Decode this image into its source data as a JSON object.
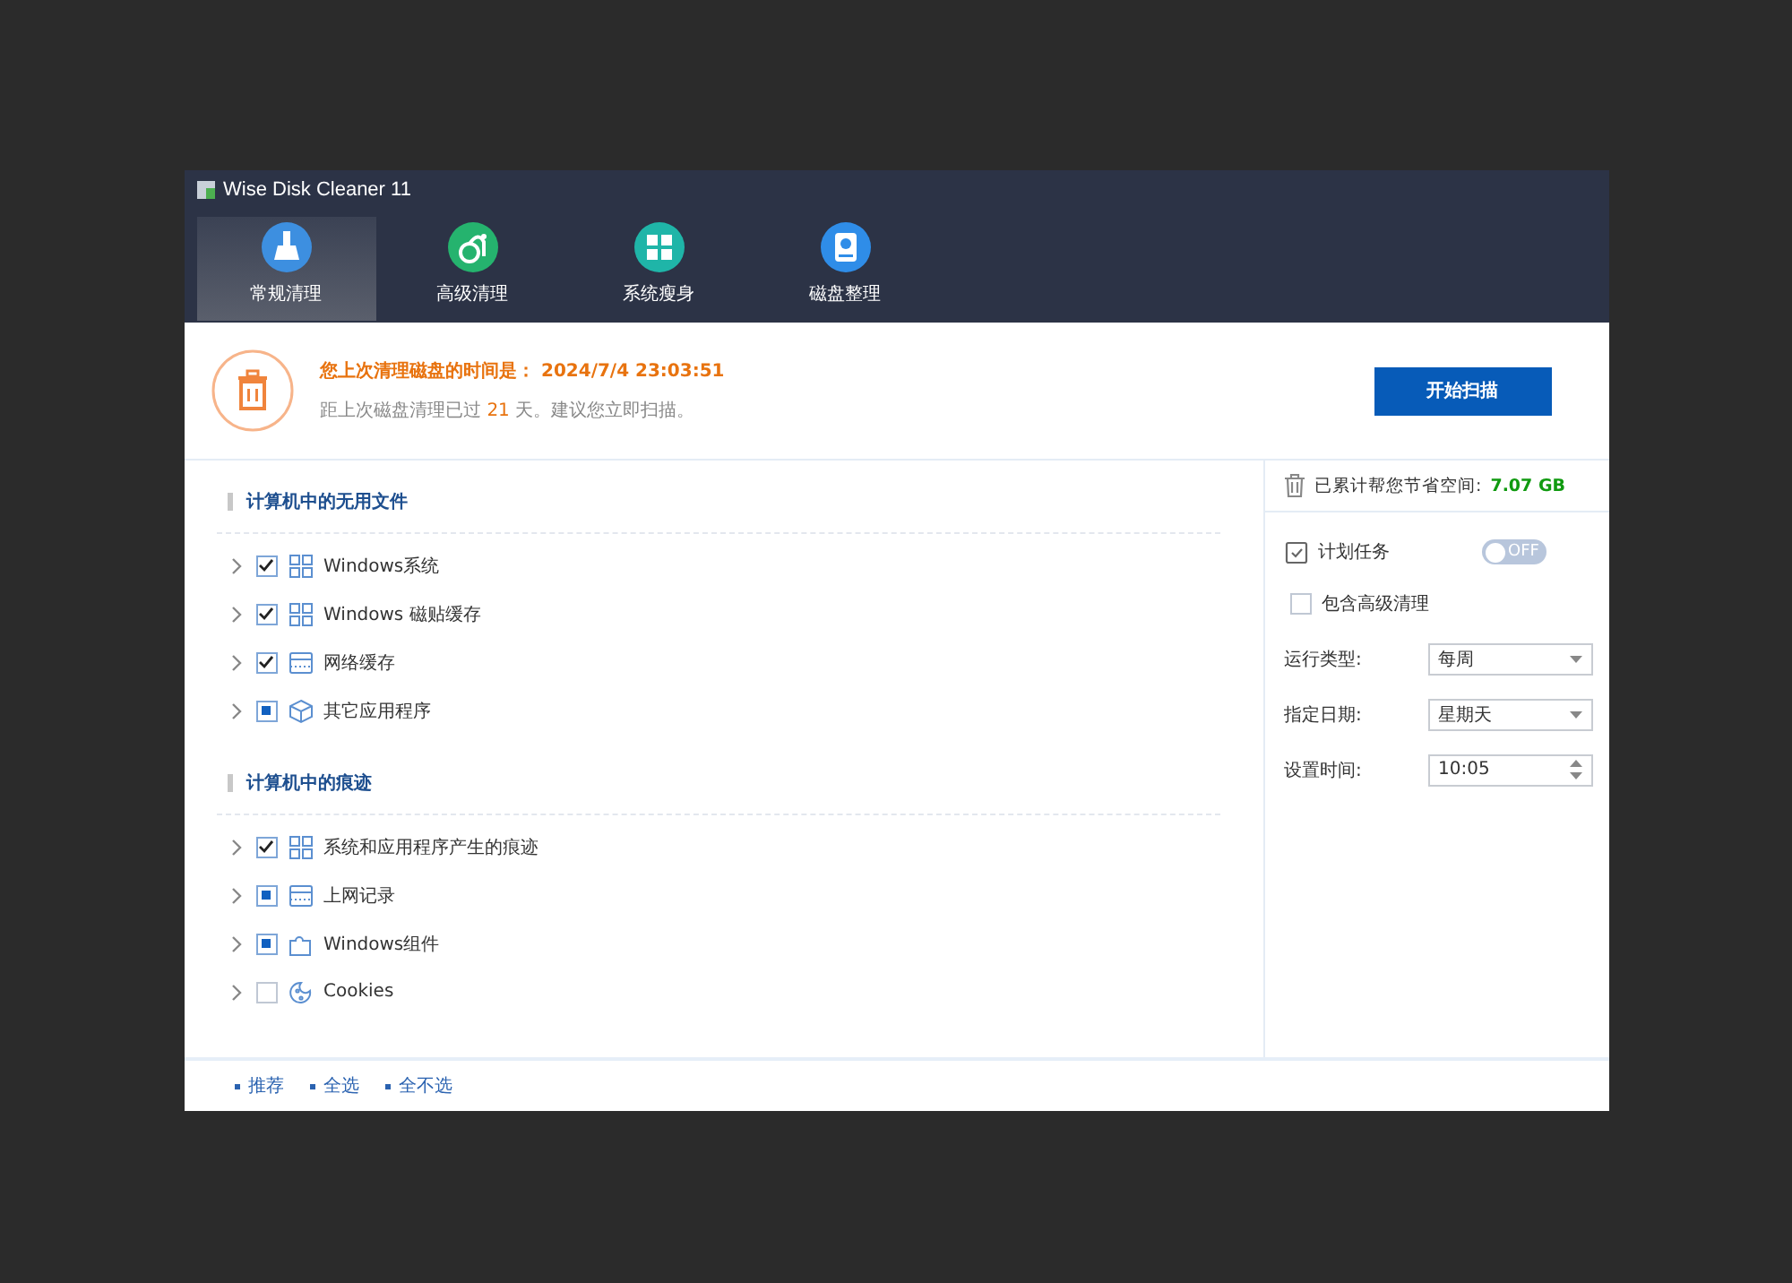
{
  "window": {
    "title": "Wise Disk Cleaner 11"
  },
  "tabs": [
    {
      "label": "常规清理",
      "selected": true
    },
    {
      "label": "高级清理",
      "selected": false
    },
    {
      "label": "系统瘦身",
      "selected": false
    },
    {
      "label": "磁盘整理",
      "selected": false
    }
  ],
  "status": {
    "last_clean_label": "您上次清理磁盘的时间是：",
    "last_clean_time": "2024/7/4 23:03:51",
    "days_prefix": "距上次磁盘清理已过",
    "days": "21",
    "days_suffix": "天。建议您立即扫描。"
  },
  "scan_button": "开始扫描",
  "sections": [
    {
      "title": "计算机中的无用文件",
      "items": [
        {
          "label": "Windows系统",
          "checked": true,
          "partial": false
        },
        {
          "label": "Windows 磁贴缓存",
          "checked": true,
          "partial": false
        },
        {
          "label": "网络缓存",
          "checked": true,
          "partial": false
        },
        {
          "label": "其它应用程序",
          "checked": true,
          "partial": true
        }
      ]
    },
    {
      "title": "计算机中的痕迹",
      "items": [
        {
          "label": "系统和应用程序产生的痕迹",
          "checked": true,
          "partial": false
        },
        {
          "label": "上网记录",
          "checked": true,
          "partial": true
        },
        {
          "label": "Windows组件",
          "checked": true,
          "partial": true
        },
        {
          "label": "Cookies",
          "checked": false,
          "partial": false
        }
      ]
    }
  ],
  "footer_links": [
    "推荐",
    "全选",
    "全不选"
  ],
  "saved": {
    "label": "已累计帮您节省空间:",
    "value": "7.07 GB"
  },
  "schedule": {
    "label": "计划任务",
    "toggle": "OFF",
    "on": false
  },
  "include_advanced": {
    "label": "包含高级清理",
    "checked": false
  },
  "fields": [
    {
      "label": "运行类型:",
      "value": "每周",
      "kind": "select"
    },
    {
      "label": "指定日期:",
      "value": "星期天",
      "kind": "select"
    },
    {
      "label": "设置时间:",
      "value": "10:05",
      "kind": "spin"
    }
  ]
}
